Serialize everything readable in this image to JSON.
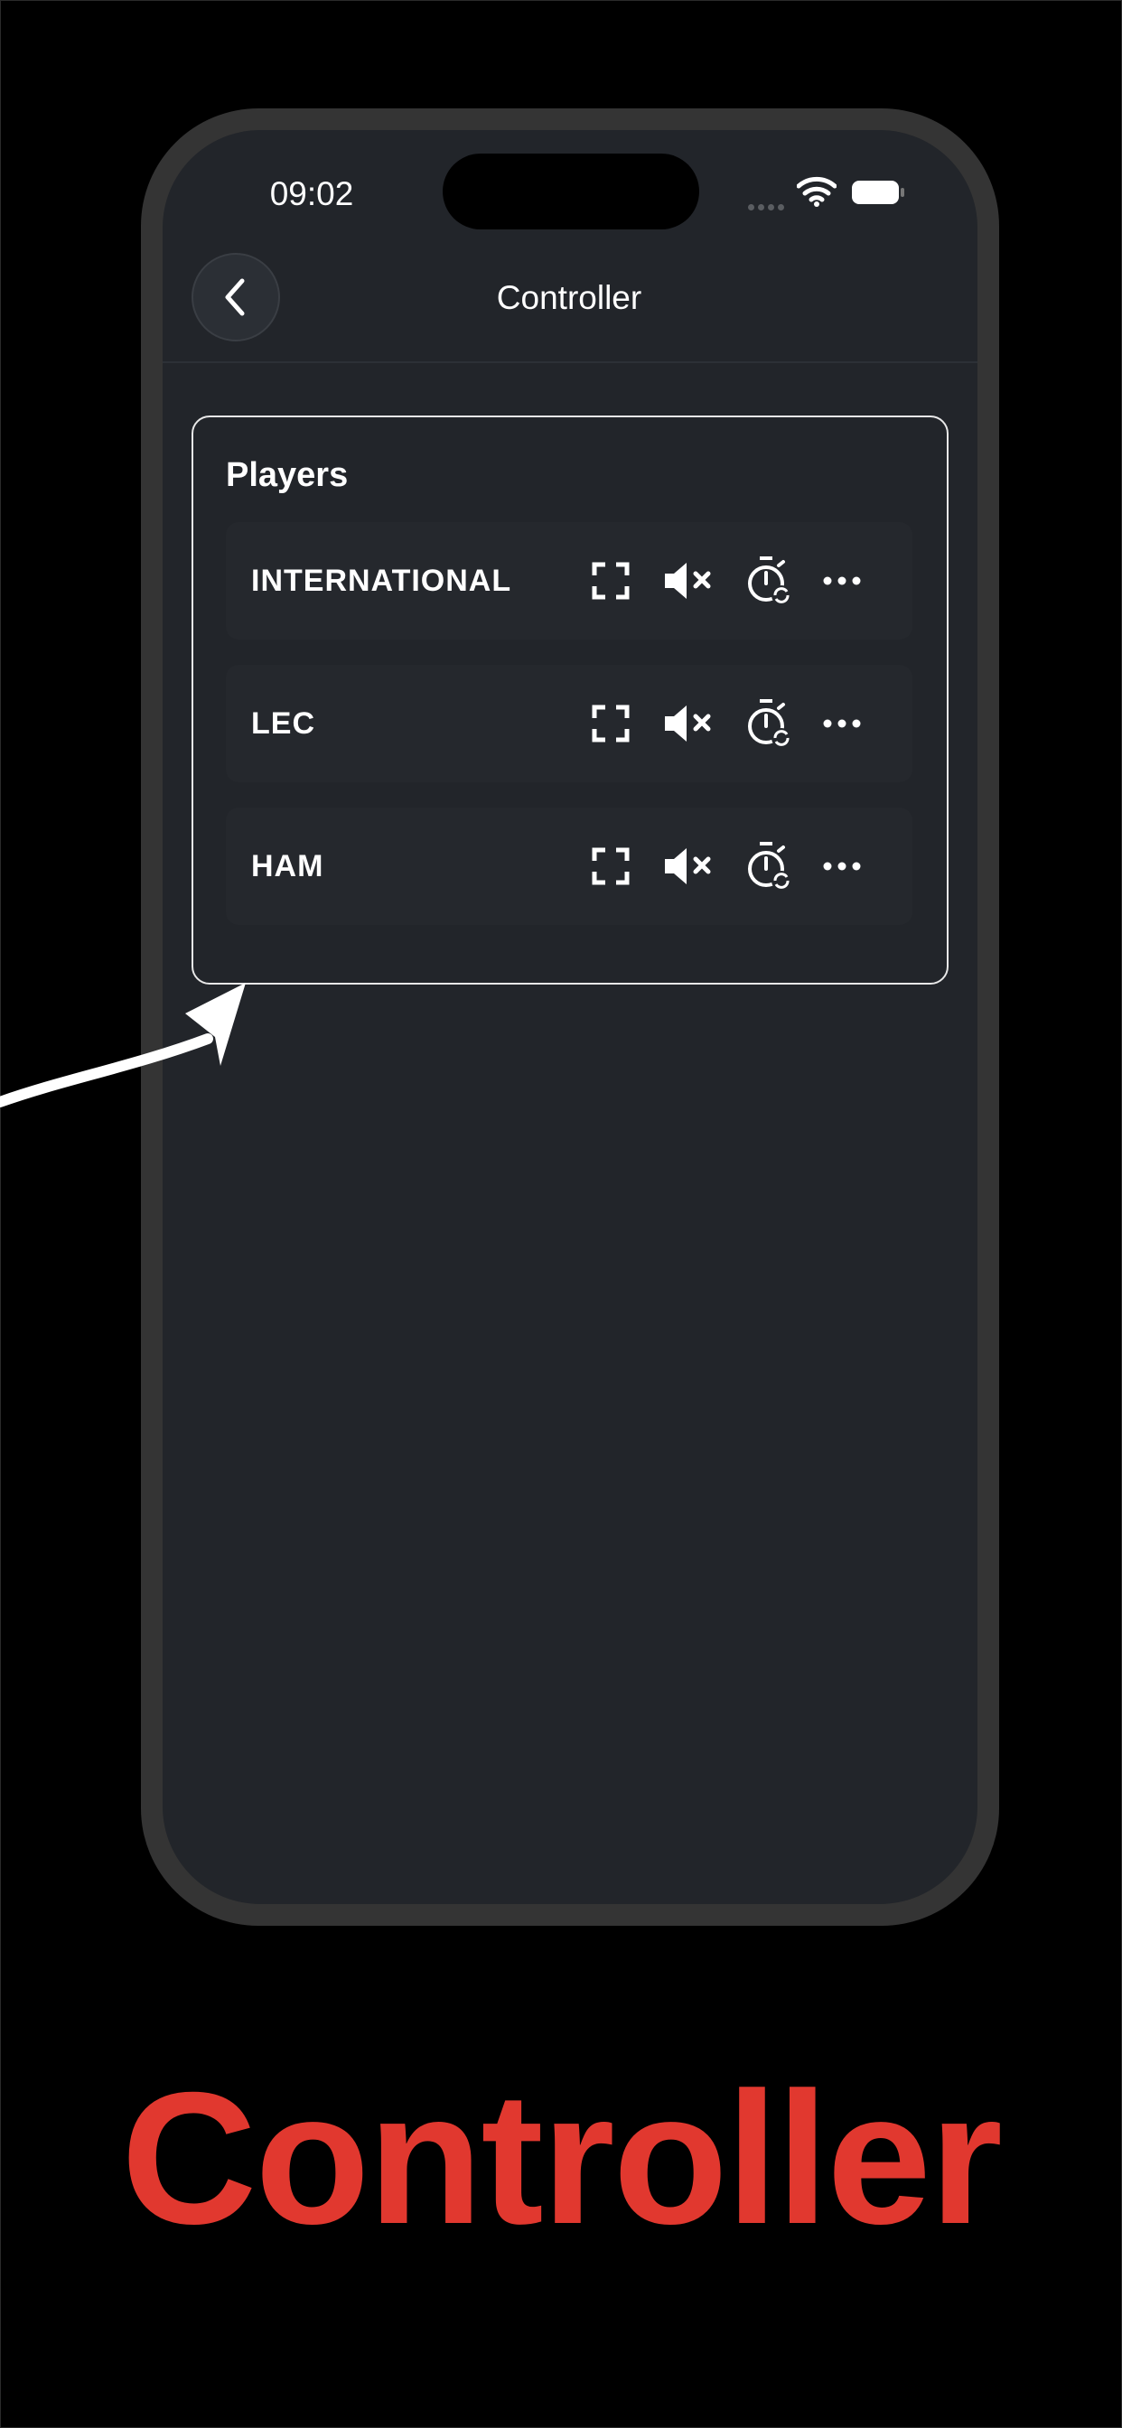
{
  "status_bar": {
    "time": "09:02"
  },
  "header": {
    "title": "Controller",
    "back_icon": "chevron-left-icon"
  },
  "players": {
    "title": "Players",
    "items": [
      {
        "name": "INTERNATIONAL"
      },
      {
        "name": "LEC"
      },
      {
        "name": "HAM"
      }
    ],
    "control_icons": [
      "fullscreen-icon",
      "mute-icon",
      "timer-sync-icon",
      "more-icon"
    ]
  },
  "caption": "Controller",
  "colors": {
    "background": "#000000",
    "screen": "#22252a",
    "caption": "#e1382f",
    "card_border": "#e8e8e8"
  }
}
